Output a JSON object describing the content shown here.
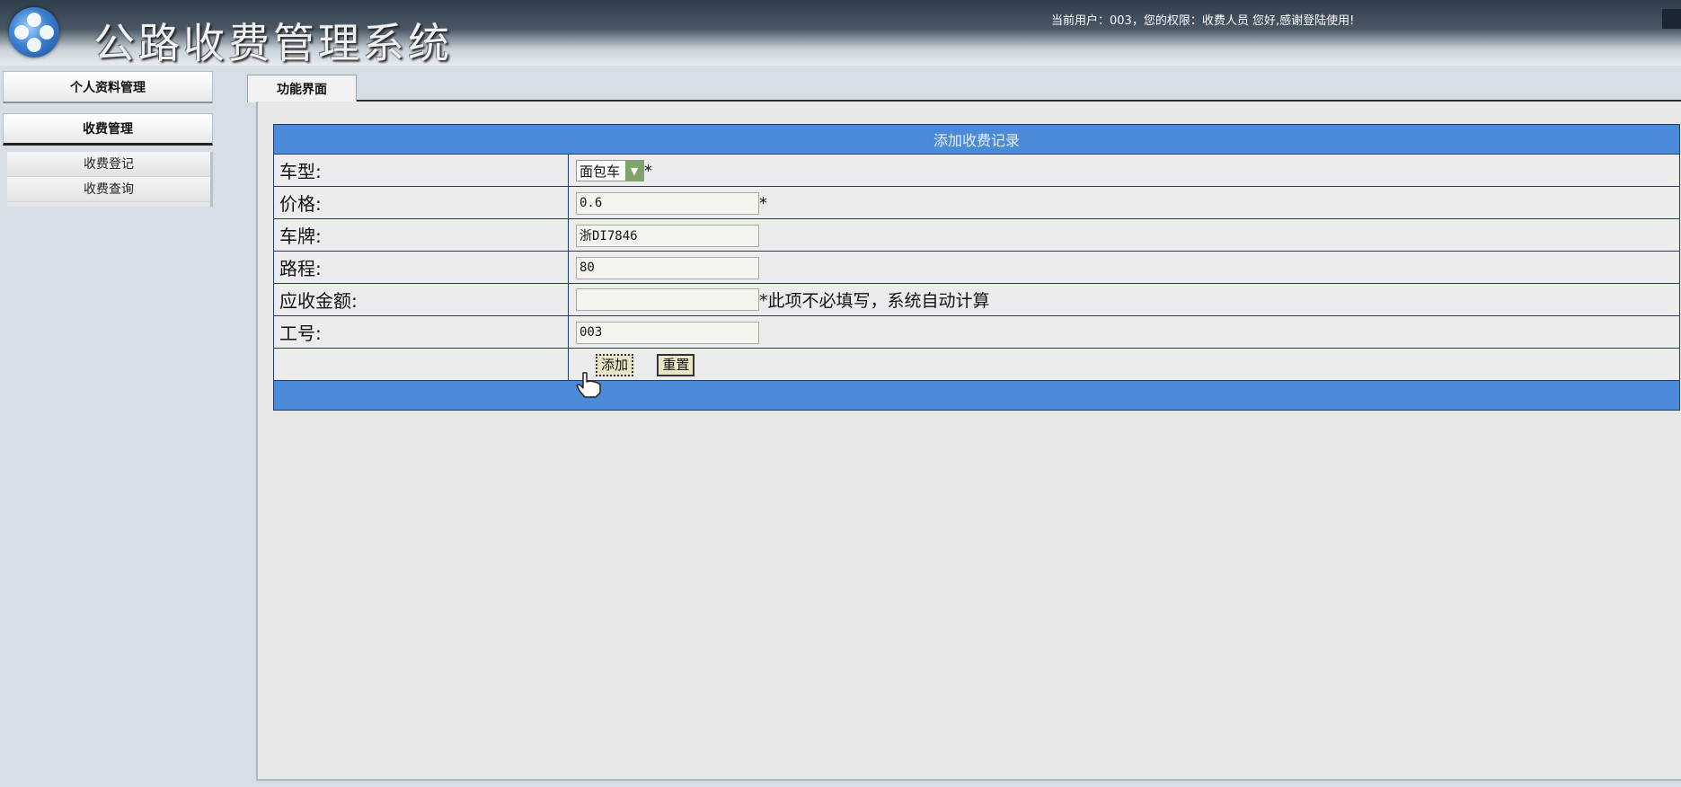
{
  "header": {
    "app_title": "公路收费管理系统",
    "user_info": "当前用户：003，您的权限：收费人员 您好,感谢登陆使用!"
  },
  "sidebar": {
    "groups": [
      {
        "label": "个人资料管理"
      },
      {
        "label": "收费管理",
        "items": [
          {
            "label": "收费登记"
          },
          {
            "label": "收费查询"
          }
        ]
      }
    ]
  },
  "main": {
    "tab_label": "功能界面",
    "form": {
      "title": "添加收费记录",
      "fields": {
        "vehicle_type": {
          "label": "车型:",
          "value": "面包车",
          "required_mark": "*"
        },
        "price": {
          "label": "价格:",
          "value": "0.6",
          "required_mark": "*"
        },
        "plate": {
          "label": "车牌:",
          "value": "浙DI7846"
        },
        "distance": {
          "label": "路程:",
          "value": "80"
        },
        "amount_due": {
          "label": "应收金额:",
          "value": "",
          "hint": "*此项不必填写，系统自动计算"
        },
        "employee_id": {
          "label": "工号:",
          "value": "003"
        }
      },
      "buttons": {
        "add": "添加",
        "reset": "重置"
      }
    }
  },
  "colors": {
    "table_header": "#4a8ad8",
    "table_border": "#1f3d73",
    "panel_bg": "#e8e8e8",
    "page_bg": "#d6dde5"
  }
}
